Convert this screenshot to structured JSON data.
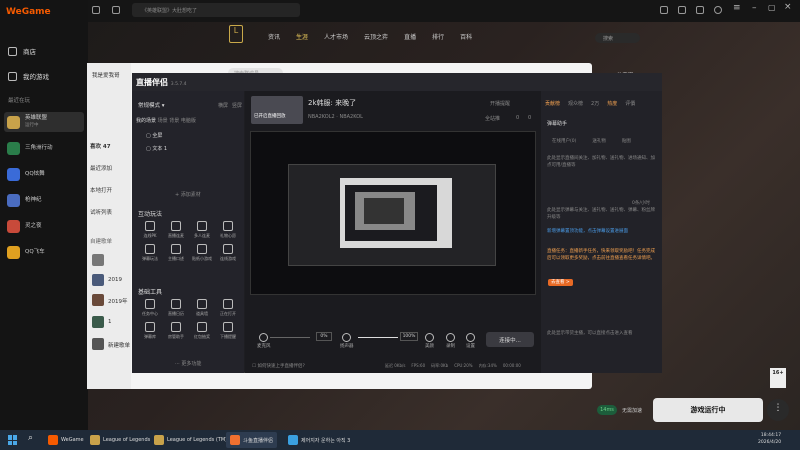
{
  "wegame": {
    "logo_we": "W",
    "logo_rest": "eGame",
    "search_placeholder": "《英雄联盟》大肚想吃了",
    "side_links": [
      "商店",
      "我的游戏"
    ],
    "recent_header": "最近在玩",
    "games": [
      {
        "label": "英雄联盟",
        "sub": "运行中",
        "color": "#c8a24a"
      },
      {
        "label": "三角洲行动",
        "sub": "",
        "color": "#2a7d4a"
      },
      {
        "label": "QQ炫舞",
        "sub": "",
        "color": "#3a6bd8"
      },
      {
        "label": "枪神纪",
        "sub": "",
        "color": "#4a6cc0"
      },
      {
        "label": "灵之夜",
        "sub": "",
        "color": "#c84a3a"
      },
      {
        "label": "QQ飞车",
        "sub": "",
        "color": "#e0a020"
      }
    ],
    "nav": [
      "资讯",
      "生涯",
      "人才市场",
      "云顶之弈",
      "直播",
      "排行",
      "百科"
    ],
    "nav_active_index": 1,
    "top_right_search": "搜索",
    "launch_label": "游戏运行中",
    "ping": "14ms",
    "ping_note": "无需加速",
    "age_badge": "16+"
  },
  "chat": {
    "header_name": "我是爱我哥",
    "header_search": "搜索群成员",
    "items": [
      {
        "label": "喜欢 47",
        "bold": true
      },
      {
        "label": "最近添加",
        "bold": false
      },
      {
        "label": "本地打开",
        "bold": false
      },
      {
        "label": "试听列表",
        "bold": false
      }
    ],
    "group_header": "自建歌单",
    "list": [
      "2019",
      "2019年",
      "1",
      "新建歌单"
    ]
  },
  "stream_app": {
    "brand": "直播伴侣",
    "version": "3.5.7.4",
    "mode": "常规模式",
    "tabs_right": [
      "横屏",
      "竖屏"
    ],
    "scenes_header": "我的场景",
    "scene_tabs": [
      "场景",
      "背景",
      "电脑版"
    ],
    "scene_items": [
      "全屏",
      "文本 1"
    ],
    "add_source": "+ 添加素材",
    "interactive_header": "互动玩法",
    "interactive_tools": [
      "连线PK",
      "直播连麦",
      "多人连麦",
      "礼物心愿",
      "弹幕玩法",
      "主播口述",
      "贴纸小游戏",
      "连线游戏"
    ],
    "basic_header": "基础工具",
    "basic_tools": [
      "任务中心",
      "直播日历",
      "道具墙",
      "正在打开",
      "弹幕库",
      "房管助手",
      "红包抽奖",
      "下播提醒"
    ],
    "more": "更多功能",
    "room_title": "2k韩服: 来晚了",
    "room_tag": "已开启直播回放",
    "room_sub": "NBA2KOL2 · NBA2KOL",
    "top_actions": [
      "开播提醒",
      "分享直播",
      "全站推",
      "0",
      "0"
    ],
    "mic_label": "麦克风",
    "speaker_label": "扬声器",
    "vol_mic": "0%",
    "vol_speaker": "100%",
    "bottom_actions": [
      "美颜",
      "录制",
      "设置"
    ],
    "connect_label": "连接中...",
    "status_line": "☐ 如何快速上手直播伴侣?",
    "stats": [
      "延迟 0Kb/s",
      "FPS:60",
      "码率:0Kb",
      "CPU:20%",
      "内存:34%",
      "00:00:00"
    ],
    "right_tabs": [
      "贡献榜",
      "观众榜",
      "2万",
      "热度",
      "评價"
    ],
    "danmu_helper": "弹幕助手",
    "sub_tabs": [
      "在线用户(0)",
      "送礼物",
      "贴图"
    ],
    "notice1": "此处显示直播间关注、加礼物、送礼物、进场通知、加点可用/直播等",
    "notice2": "此处显示弹幕与关注、送礼物、送礼物、弹幕、粉丝牌升级等",
    "blue1": "新增弹幕置顶功能，点击弹幕设置进展面",
    "orange1": "直播任务：直播新手任务，快来领取奖励吧！任务完成后可以领取更多奖励，点击前往直播查看任务详情吧。",
    "orange_link": "去查看 >",
    "notice3": "此处显示带货主播，可以直接点击进入查看",
    "limit": "0条/小时"
  },
  "taskbar": {
    "items": [
      "WeGame",
      "League of Legends",
      "League of Legends (TM)",
      "斗鱼直播伴侣",
      "제어지자 운하는 아직 3"
    ],
    "time": "18:44:17",
    "date": "2026/4/20"
  }
}
